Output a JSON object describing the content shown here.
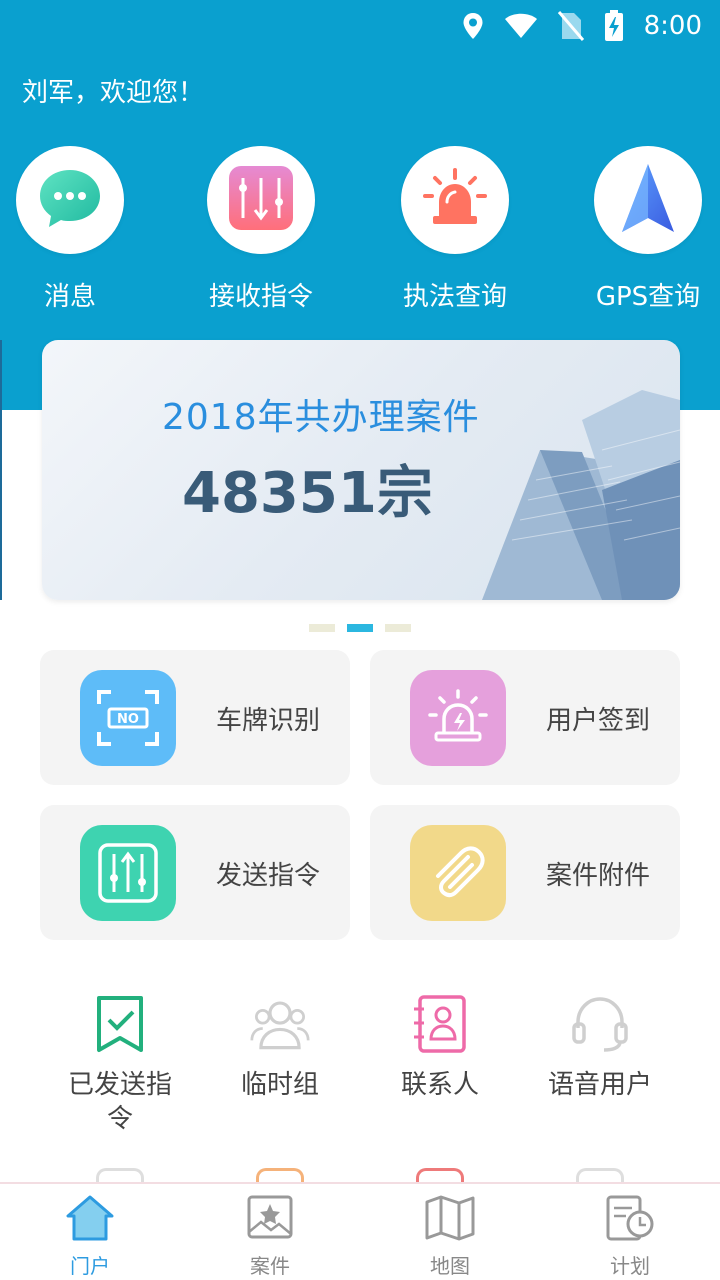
{
  "status_bar": {
    "time": "8:00",
    "icons": [
      "location-icon",
      "wifi-icon",
      "no-sim-icon",
      "battery-charging-icon"
    ]
  },
  "header": {
    "welcome": "刘军，欢迎您！"
  },
  "quick_actions": [
    {
      "label": "消息",
      "icon": "chat-bubble-icon"
    },
    {
      "label": "接收指令",
      "icon": "equalizer-download-icon"
    },
    {
      "label": "执法查询",
      "icon": "siren-icon"
    },
    {
      "label": "GPS查询",
      "icon": "navigation-arrow-icon"
    }
  ],
  "banner": {
    "title": "2018年共办理案件",
    "count": "48351宗",
    "pages": 3,
    "active_page": 2
  },
  "feature_cards": [
    {
      "label": "车牌识别",
      "icon": "license-plate-scan-icon",
      "color": "#5ebcf8"
    },
    {
      "label": "用户签到",
      "icon": "alarm-light-icon",
      "color": "#e5a0dc"
    },
    {
      "label": "发送指令",
      "icon": "equalizer-upload-icon",
      "color": "#3ed3b0"
    },
    {
      "label": "案件附件",
      "icon": "paperclip-icon",
      "color": "#f2d98a"
    }
  ],
  "function_grid": [
    {
      "label": "已发送指令",
      "icon": "bookmark-check-icon",
      "color": "#22b07d"
    },
    {
      "label": "临时组",
      "icon": "group-icon",
      "color": "#cfcfcf"
    },
    {
      "label": "联系人",
      "icon": "contact-book-icon",
      "color": "#ee6aa8"
    },
    {
      "label": "语音用户",
      "icon": "headset-icon",
      "color": "#cfcfcf"
    }
  ],
  "bottom_nav": [
    {
      "label": "门户",
      "icon": "home-icon",
      "active": true
    },
    {
      "label": "案件",
      "icon": "case-star-icon",
      "active": false
    },
    {
      "label": "地图",
      "icon": "map-icon",
      "active": false
    },
    {
      "label": "计划",
      "icon": "plan-clock-icon",
      "active": false
    }
  ],
  "colors": {
    "header": "#0aa0cf",
    "accent": "#2d9be0",
    "banner_title": "#2a8ede",
    "banner_count": "#395b78"
  }
}
